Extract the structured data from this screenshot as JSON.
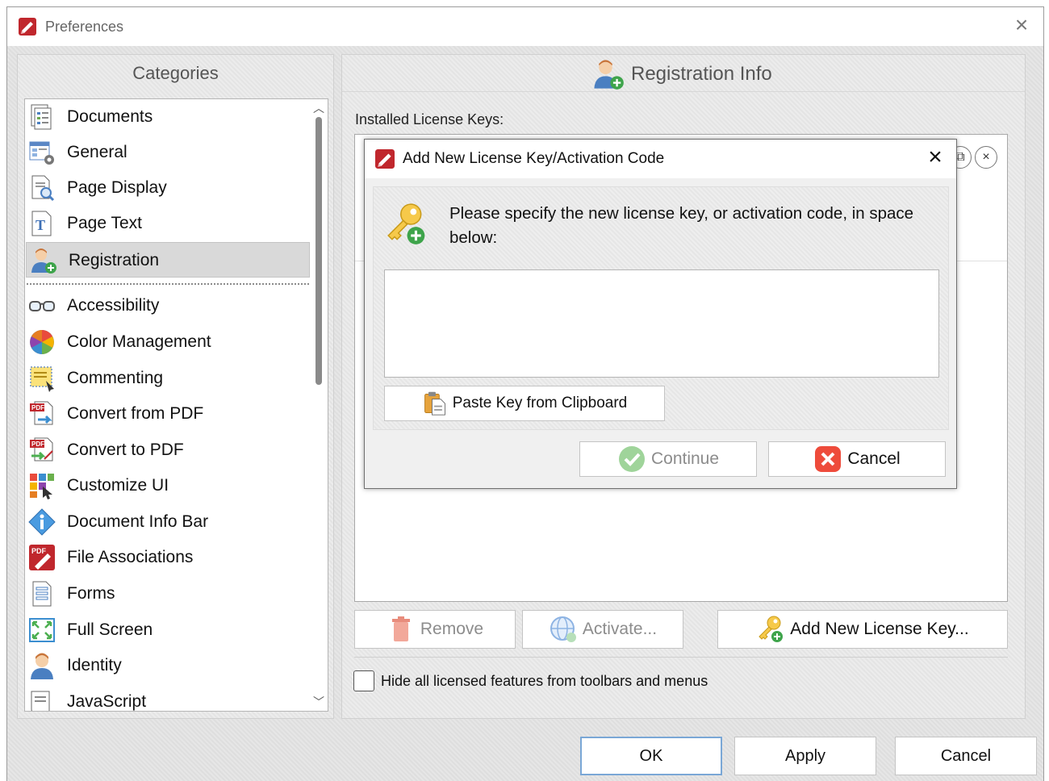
{
  "window": {
    "title": "Preferences"
  },
  "categories": {
    "header": "Categories",
    "items": [
      {
        "label": "Documents",
        "icon": "documents-icon"
      },
      {
        "label": "General",
        "icon": "general-settings-icon"
      },
      {
        "label": "Page Display",
        "icon": "page-display-icon"
      },
      {
        "label": "Page Text",
        "icon": "page-text-icon"
      },
      {
        "label": "Registration",
        "icon": "registration-icon",
        "selected": true
      },
      {
        "label": "Accessibility",
        "icon": "glasses-icon"
      },
      {
        "label": "Color Management",
        "icon": "color-wheel-icon"
      },
      {
        "label": "Commenting",
        "icon": "commenting-icon"
      },
      {
        "label": "Convert from PDF",
        "icon": "convert-from-pdf-icon"
      },
      {
        "label": "Convert to PDF",
        "icon": "convert-to-pdf-icon"
      },
      {
        "label": "Customize UI",
        "icon": "customize-ui-icon"
      },
      {
        "label": "Document Info Bar",
        "icon": "info-icon"
      },
      {
        "label": "File Associations",
        "icon": "pdf-file-icon"
      },
      {
        "label": "Forms",
        "icon": "forms-icon"
      },
      {
        "label": "Full Screen",
        "icon": "full-screen-icon"
      },
      {
        "label": "Identity",
        "icon": "identity-icon"
      },
      {
        "label": "JavaScript",
        "icon": "javascript-icon"
      }
    ]
  },
  "registration": {
    "header": "Registration Info",
    "installed_label": "Installed License Keys:",
    "remove_label": "Remove",
    "activate_label": "Activate...",
    "add_key_label": "Add New License Key...",
    "hide_features_label": "Hide all licensed features from toolbars and menus"
  },
  "dialog": {
    "title": "Add New License Key/Activation Code",
    "prompt": "Please specify the new license key, or activation code, in space below:",
    "key_value": "",
    "paste_label": "Paste Key from Clipboard",
    "continue_label": "Continue",
    "cancel_label": "Cancel"
  },
  "footer": {
    "ok_label": "OK",
    "apply_label": "Apply",
    "cancel_label": "Cancel"
  },
  "colors": {
    "brand_red": "#c0272d",
    "selection": "#d9d9d9",
    "primary_border": "#7aa7d6"
  }
}
